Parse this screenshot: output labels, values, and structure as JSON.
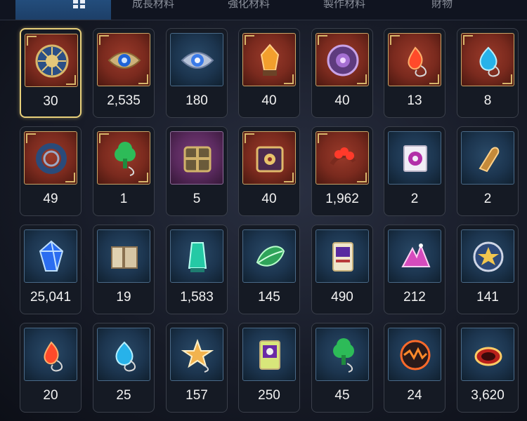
{
  "tabs": [
    {
      "label": "",
      "active": true
    },
    {
      "label": "成長材料"
    },
    {
      "label": "強化材料"
    },
    {
      "label": "製作材料"
    },
    {
      "label": "財物"
    }
  ],
  "items": [
    {
      "icon": "sun-emblem-icon",
      "count": "30",
      "rarity": "red",
      "selected": true
    },
    {
      "icon": "blue-eye-emblem-icon",
      "count": "2,535",
      "rarity": "red"
    },
    {
      "icon": "silver-eye-emblem-icon",
      "count": "180",
      "rarity": "blue"
    },
    {
      "icon": "amber-crystal-icon",
      "count": "40",
      "rarity": "red"
    },
    {
      "icon": "purple-coin-icon",
      "count": "40",
      "rarity": "red"
    },
    {
      "icon": "red-flame-pendant-icon",
      "count": "13",
      "rarity": "red"
    },
    {
      "icon": "blue-drop-pendant-icon",
      "count": "8",
      "rarity": "red"
    },
    {
      "icon": "blue-coil-pendant-icon",
      "count": "49",
      "rarity": "red"
    },
    {
      "icon": "green-tree-pendant-icon",
      "count": "1",
      "rarity": "red"
    },
    {
      "icon": "gold-box-icon",
      "count": "5",
      "rarity": "purple"
    },
    {
      "icon": "ornate-box-icon",
      "count": "40",
      "rarity": "red"
    },
    {
      "icon": "flower-necklace-icon",
      "count": "1,962",
      "rarity": "red"
    },
    {
      "icon": "stamp-ticket-icon",
      "count": "2",
      "rarity": "blue"
    },
    {
      "icon": "bullet-icon",
      "count": "2",
      "rarity": "blue"
    },
    {
      "icon": "blue-gem-icon",
      "count": "25,041",
      "rarity": "blue"
    },
    {
      "icon": "book-icon",
      "count": "19",
      "rarity": "blue"
    },
    {
      "icon": "green-crystal-icon",
      "count": "1,583",
      "rarity": "blue"
    },
    {
      "icon": "leaf-icon",
      "count": "145",
      "rarity": "blue"
    },
    {
      "icon": "card-icon",
      "count": "490",
      "rarity": "blue"
    },
    {
      "icon": "pink-crystal-pile-icon",
      "count": "212",
      "rarity": "blue"
    },
    {
      "icon": "star-coin-icon",
      "count": "141",
      "rarity": "blue"
    },
    {
      "icon": "red-flame-pendant-icon",
      "count": "20",
      "rarity": "blue"
    },
    {
      "icon": "blue-drop-pendant-icon",
      "count": "25",
      "rarity": "blue"
    },
    {
      "icon": "star-pendant-icon",
      "count": "157",
      "rarity": "blue"
    },
    {
      "icon": "purple-cat-card-icon",
      "count": "250",
      "rarity": "blue"
    },
    {
      "icon": "green-tree-pendant-icon",
      "count": "45",
      "rarity": "blue"
    },
    {
      "icon": "lava-orb-icon",
      "count": "24",
      "rarity": "blue"
    },
    {
      "icon": "red-bracelet-icon",
      "count": "3,620",
      "rarity": "blue"
    }
  ],
  "colors": {
    "selected_border": "#e7cf7a",
    "count_text": "#f2f2f2",
    "active_tab": "#234d7c"
  }
}
